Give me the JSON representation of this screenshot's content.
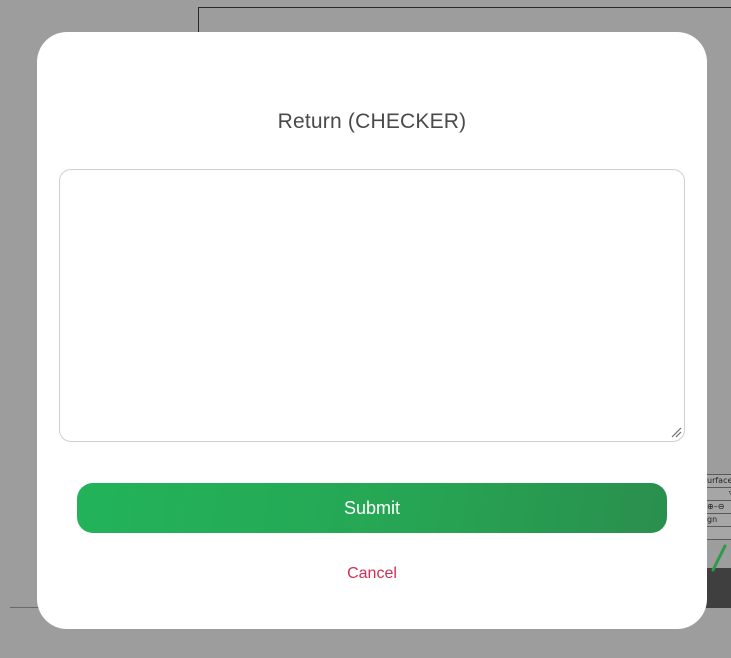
{
  "background": {
    "legend": {
      "row1": "urface",
      "row2": "▽▽",
      "row3": "⊕–⊖",
      "row4": "gn"
    }
  },
  "dialog": {
    "title": "Return (CHECKER)",
    "comment_value": "",
    "comment_placeholder": "",
    "submit_label": "Submit",
    "cancel_label": "Cancel"
  },
  "colors": {
    "overlay": "#9d9d9d",
    "submit_green": "#26a654",
    "cancel_red": "#d32f55",
    "title_text": "#4a4a4a"
  },
  "icons": {
    "resize_handle": "textarea-resize-icon"
  }
}
